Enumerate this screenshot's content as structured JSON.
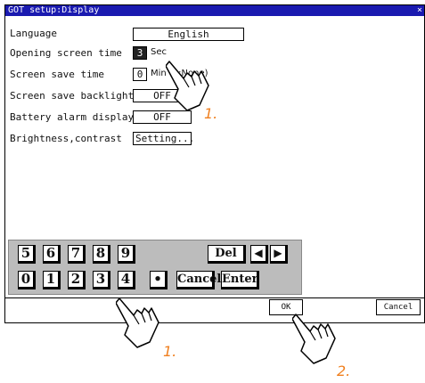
{
  "window": {
    "title": "GOT setup:Display",
    "close_glyph": "×"
  },
  "settings": [
    {
      "label": "Language",
      "value": "English",
      "unit": ""
    },
    {
      "label": "Opening screen time",
      "value": "3",
      "unit": "Sec"
    },
    {
      "label": "Screen save time",
      "value": "0",
      "unit": "Min (0:None)"
    },
    {
      "label": "Screen save backlight",
      "value": "OFF",
      "unit": ""
    },
    {
      "label": "Battery alarm display",
      "value": "OFF",
      "unit": ""
    },
    {
      "label": "Brightness,contrast",
      "value": "Setting...",
      "unit": ""
    }
  ],
  "keypad": {
    "row1": [
      "5",
      "6",
      "7",
      "8",
      "9"
    ],
    "row2": [
      "0",
      "1",
      "2",
      "3",
      "4"
    ],
    "del": "Del",
    "cancel": "Cancel",
    "enter": "Enter",
    "dot": "•",
    "left_arrow": "◀",
    "right_arrow": "▶"
  },
  "buttons": {
    "ok": "OK",
    "cancel": "Cancel"
  },
  "annotations": {
    "step1": "1.",
    "step1b": "1.",
    "step2": "2."
  }
}
